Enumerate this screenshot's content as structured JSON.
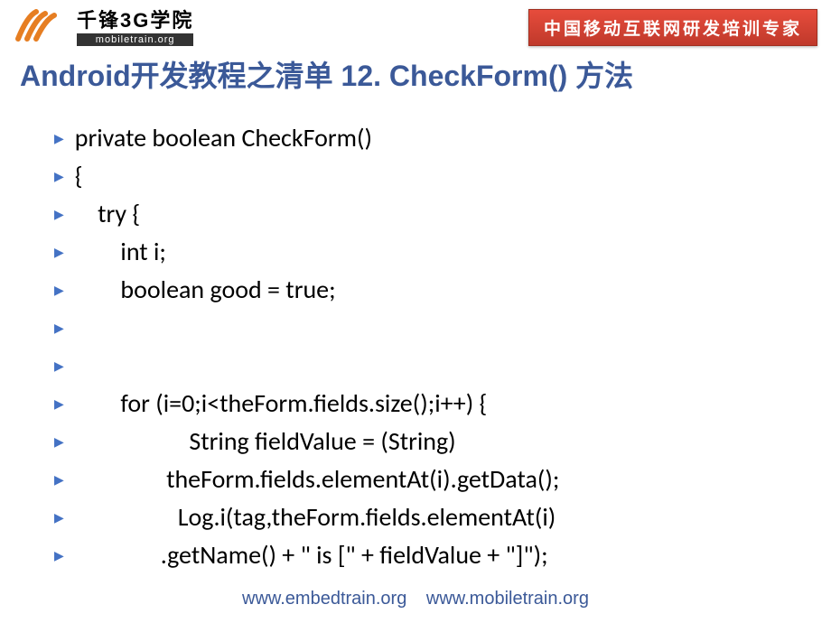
{
  "header": {
    "brand_main": "千锋3G学院",
    "brand_sub": "mobiletrain.org",
    "banner": "中国移动互联网研发培训专家"
  },
  "title": "Android开发教程之清单 12. CheckForm() 方法",
  "code_lines": [
    "private boolean CheckForm()",
    "{",
    "    try {",
    "        int i;",
    "        boolean good = true;",
    "",
    "",
    "        for (i=0;i<theForm.fields.size();i++) {",
    "                    String fieldValue = (String)",
    "                theForm.fields.elementAt(i).getData();",
    "                  Log.i(tag,theForm.fields.elementAt(i)",
    "               .getName() + \" is [\" + fieldValue + \"]\");"
  ],
  "footer": {
    "link1": "www.embedtrain.org",
    "link2": "www.mobiletrain.org"
  }
}
